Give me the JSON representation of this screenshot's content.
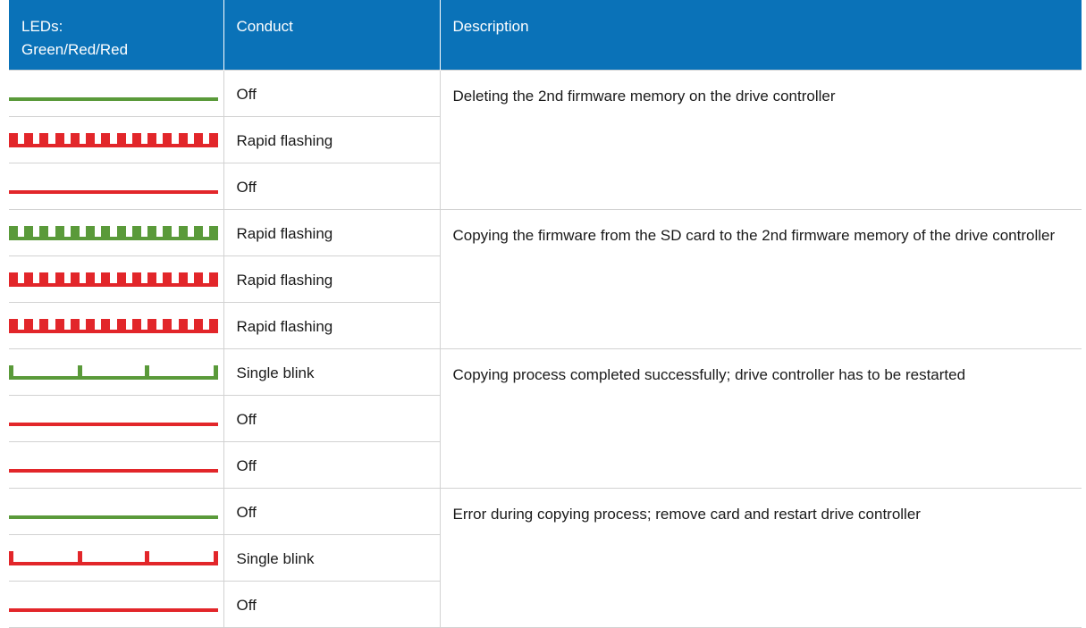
{
  "header": {
    "leds_line1": "LEDs:",
    "leds_line2": "Green/Red/Red",
    "conduct": "Conduct",
    "description": "Description"
  },
  "colors": {
    "green": "#5a9a3a",
    "red": "#e2262a",
    "header_bg": "#0a72b8"
  },
  "groups": [
    {
      "description": "Deleting the 2nd firmware memory on the drive controller",
      "rows": [
        {
          "pattern": "off",
          "color": "green",
          "conduct": "Off"
        },
        {
          "pattern": "rapid",
          "color": "red",
          "conduct": "Rapid flashing"
        },
        {
          "pattern": "off",
          "color": "red",
          "conduct": "Off"
        }
      ]
    },
    {
      "description": "Copying the firmware from the SD card to the 2nd firmware memory of the drive controller",
      "rows": [
        {
          "pattern": "rapid",
          "color": "green",
          "conduct": "Rapid flashing"
        },
        {
          "pattern": "rapid",
          "color": "red",
          "conduct": "Rapid flashing"
        },
        {
          "pattern": "rapid",
          "color": "red",
          "conduct": "Rapid flashing"
        }
      ]
    },
    {
      "description": "Copying process completed successfully; drive controller has to be restarted",
      "rows": [
        {
          "pattern": "single",
          "color": "green",
          "conduct": "Single blink"
        },
        {
          "pattern": "off",
          "color": "red",
          "conduct": "Off"
        },
        {
          "pattern": "off",
          "color": "red",
          "conduct": "Off"
        }
      ]
    },
    {
      "description": "Error during copying process; remove card and restart drive controller",
      "rows": [
        {
          "pattern": "off",
          "color": "green",
          "conduct": "Off"
        },
        {
          "pattern": "single",
          "color": "red",
          "conduct": "Single blink"
        },
        {
          "pattern": "off",
          "color": "red",
          "conduct": "Off"
        }
      ]
    }
  ]
}
